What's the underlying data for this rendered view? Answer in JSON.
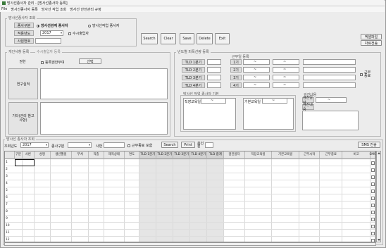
{
  "window": {
    "title": "방사선종사자 관리 - [방사선종사자 등록]"
  },
  "menu": [
    "File",
    "방사선종사자 등록",
    "방사선 작업 조회",
    "방사선 안전관리 규정"
  ],
  "search_panel": {
    "title": "방사선종사자 조회",
    "category_label": "종사구분",
    "radio_worker": "방사선관계 종사자",
    "radio_occasional": "방사선작업 종사자",
    "year_label": "적용년도",
    "year_value": "2017",
    "occasional_label": "수시출입자",
    "id_label": "사원번호"
  },
  "toolbar": {
    "search": "Search",
    "clear": "Clear",
    "save": "Save",
    "delete": "Delete",
    "exit": "Exit"
  },
  "side_buttons": {
    "excel": "엑셀파일",
    "data_transfer": "자료전송"
  },
  "history": {
    "title": "개인사항 등록",
    "sub_title": "수시출입자 등록",
    "rank_label": "권한",
    "rank_check": "등록권한부여",
    "select_btn": "선택",
    "career_label": "연구실적",
    "note_label": "기타(관리 참고사항)"
  },
  "tld": {
    "title": "년도별 피폭선량 등록",
    "quarters": [
      "TLD 1분기",
      "TLD 2분기",
      "TLD 3분기",
      "TLD 4분기"
    ],
    "period_title": "근무일 등록",
    "periods": [
      "1기",
      "2기",
      "3기",
      "4기"
    ],
    "dash": "~",
    "side_check": "근무종료"
  },
  "edu": {
    "title": "방사선 작업 종사자 기본",
    "job_edu": "직장교육일",
    "basic_edu": "기본교육일",
    "dash": "~"
  },
  "health": {
    "title": "검진내용",
    "date_label": "검진일자",
    "content_label": "검진내용",
    "dash": "~"
  },
  "list_panel": {
    "title": "방사선 종사자 조회",
    "year_label": "조회년도",
    "year_value": "2017",
    "category_label": "종사구분",
    "name_label": "사번",
    "retired_label": "근무종료 포함",
    "search": "Search",
    "print": "Print",
    "count_label": "총인원",
    "sms": "SMS 전송"
  },
  "table": {
    "columns": [
      "구분",
      "사번",
      "성명",
      "생년월일",
      "부서",
      "직종",
      "재직상태",
      "연도",
      "TLD 1분기",
      "TLD 2분기",
      "TLD 3분기",
      "TLD 4분기",
      "TLD 합계",
      "검진일자",
      "직장교육일",
      "기본교육일",
      "근무시작",
      "근무종료",
      "비고",
      "SMS"
    ],
    "rows": [
      "1",
      "2",
      "3",
      "4",
      "5",
      "6",
      "7",
      "8",
      "9",
      "10",
      "11",
      "12"
    ]
  }
}
